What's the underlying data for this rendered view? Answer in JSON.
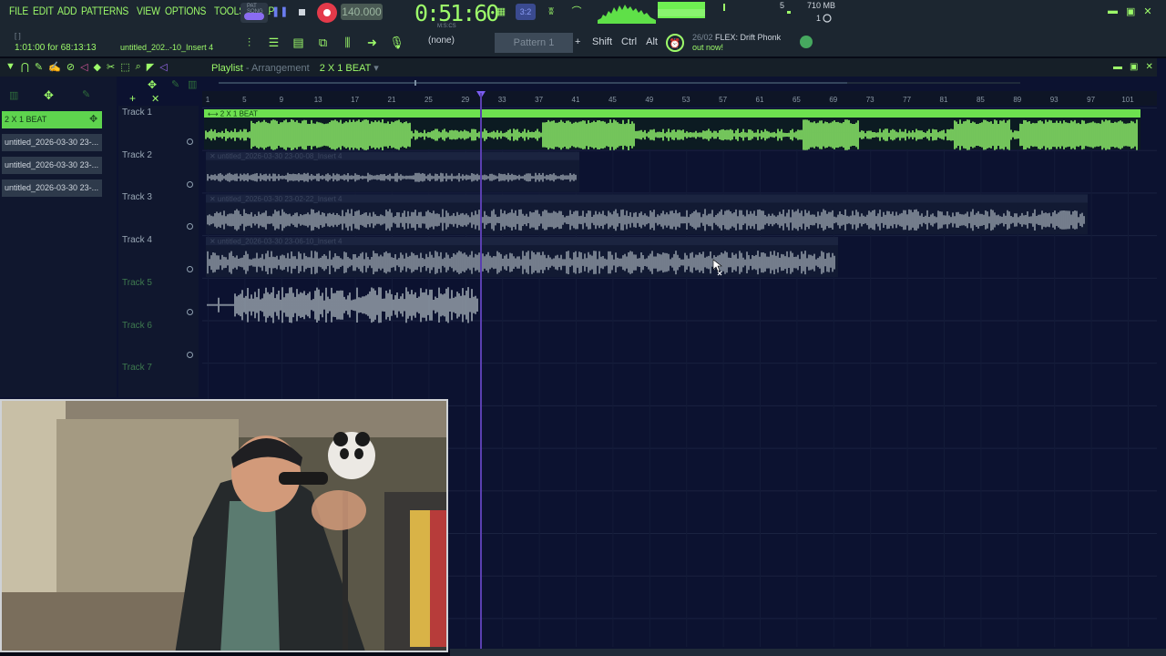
{
  "menu": [
    "FILE",
    "EDIT",
    "ADD",
    "PATTERNS",
    "VIEW",
    "OPTIONS",
    "TOOLS",
    "HELP"
  ],
  "transport": {
    "mode_label": "PAT SONG",
    "tempo": "140.000",
    "time": "0:51:60",
    "time_sub": "M:S:CS"
  },
  "stats": {
    "polyphony": "5",
    "memory": "710 MB",
    "cpu_cores": "1"
  },
  "hint_bar": {
    "hint": "1:01:00 for 68:13:13",
    "top": "[ ]"
  },
  "file_title": "untitled_202..-10_Insert 4",
  "pattern": {
    "none_label": "(none)",
    "selected": "Pattern 1",
    "plus": "+"
  },
  "mod_keys": [
    "Shift",
    "Ctrl",
    "Alt"
  ],
  "news": {
    "date": "26/02",
    "line1": "FLEX: Drift Phonk",
    "line2": "out now!"
  },
  "playlist": {
    "title": "Playlist",
    "arrangement": "Arrangement",
    "pattern_name": "2 X 1 BEAT"
  },
  "picker_items": [
    "2 X 1 BEAT",
    "untitled_2026-03-30 23-...",
    "untitled_2026-03-30 23-...",
    "untitled_2026-03-30 23-..."
  ],
  "tracks": [
    "Track 1",
    "Track 2",
    "Track 3",
    "Track 4",
    "Track 5",
    "Track 6",
    "Track 7"
  ],
  "timeline_bars": [
    "1",
    "5",
    "9",
    "13",
    "17",
    "21",
    "25",
    "29",
    "33",
    "37",
    "41",
    "45",
    "49",
    "53",
    "57",
    "61",
    "65",
    "69",
    "73",
    "77",
    "81",
    "85",
    "89",
    "93",
    "97",
    "101"
  ],
  "clips": [
    {
      "label": "2 X 1 BEAT",
      "color": "#8ef06a"
    },
    {
      "label": "untitled_2026-03-30 23-00-08_Insert 4",
      "color": "#8c96a2"
    },
    {
      "label": "untitled_2026-03-30 23-02-22_Insert 4",
      "color": "#8c96a2"
    },
    {
      "label": "untitled_2026-03-30 23-06-10_Insert 4",
      "color": "#8c96a2"
    },
    {
      "label": "",
      "color": "#9aa4ae"
    }
  ]
}
